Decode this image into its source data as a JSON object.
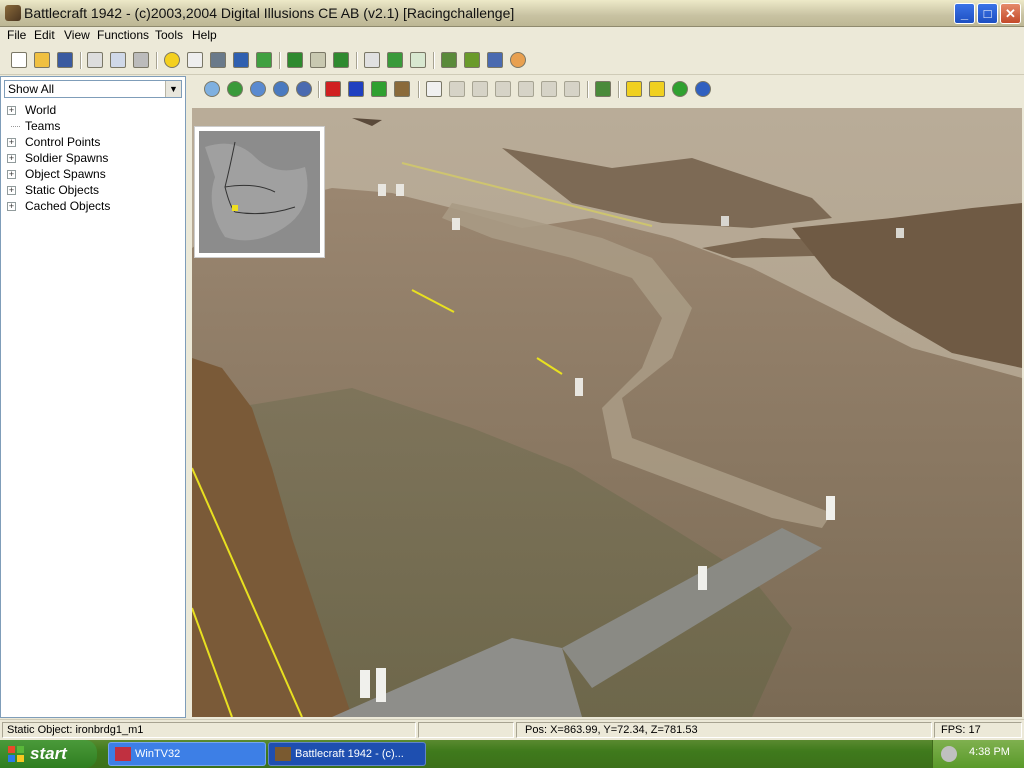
{
  "window": {
    "title": "Battlecraft 1942 - (c)2003,2004 Digital Illusions CE AB (v2.1) [Racingchallenge]",
    "minimize": "_",
    "maximize": "□",
    "close": "✕"
  },
  "menu": [
    "File",
    "Edit",
    "View",
    "Functions",
    "Tools",
    "Help"
  ],
  "toolbar_icons": [
    "new-icon",
    "open-icon",
    "save-icon",
    "cut-icon",
    "copy-icon",
    "paste-icon",
    "light-icon",
    "square-icon",
    "people-icon",
    "terrain-icon",
    "grid-icon",
    "layer-icon",
    "layer-edit-icon",
    "layer-down-icon",
    "grid-small-icon",
    "grid-green-icon",
    "grid-dots-icon",
    "objects-icon",
    "map-icon",
    "sphere-icon",
    "palette-icon"
  ],
  "viewport_toolbar_icons": [
    "home-icon",
    "globe-icon",
    "wireframe-icon",
    "info-icon",
    "flag-icon",
    "red-cube-icon",
    "blue-cube-icon",
    "green-cube-icon",
    "tank-icon",
    "select-arrow-icon",
    "move-icon",
    "move-vertical-icon",
    "rotate-icon",
    "rotate-2-icon",
    "rotate-3-icon",
    "scale-icon",
    "layers-icon",
    "lock-icon",
    "lock-2-icon",
    "lock-green-icon",
    "lock-blue-icon"
  ],
  "left_panel": {
    "filter": "Show All",
    "tree": [
      {
        "label": "World",
        "expandable": true
      },
      {
        "label": "Teams",
        "expandable": false
      },
      {
        "label": "Control Points",
        "expandable": true
      },
      {
        "label": "Soldier Spawns",
        "expandable": true
      },
      {
        "label": "Object Spawns",
        "expandable": true
      },
      {
        "label": "Static Objects",
        "expandable": true
      },
      {
        "label": "Cached Objects",
        "expandable": true
      }
    ]
  },
  "status": {
    "selection": "Static Object: ironbrdg1_m1",
    "position": "Pos: X=863.99, Y=72.34, Z=781.53",
    "fps": "FPS: 17"
  },
  "taskbar": {
    "start": "start",
    "tasks": [
      "WinTV32",
      "Battlecraft 1942 - (c)..."
    ],
    "clock": "4:38 PM"
  },
  "colors": {
    "titlebar": "#c8c2a2",
    "xp_blue": "#1d4fc2",
    "taskbar_green": "#3f7a1c",
    "sky_haze": "#b6a994",
    "terrain": "#8a7258"
  }
}
